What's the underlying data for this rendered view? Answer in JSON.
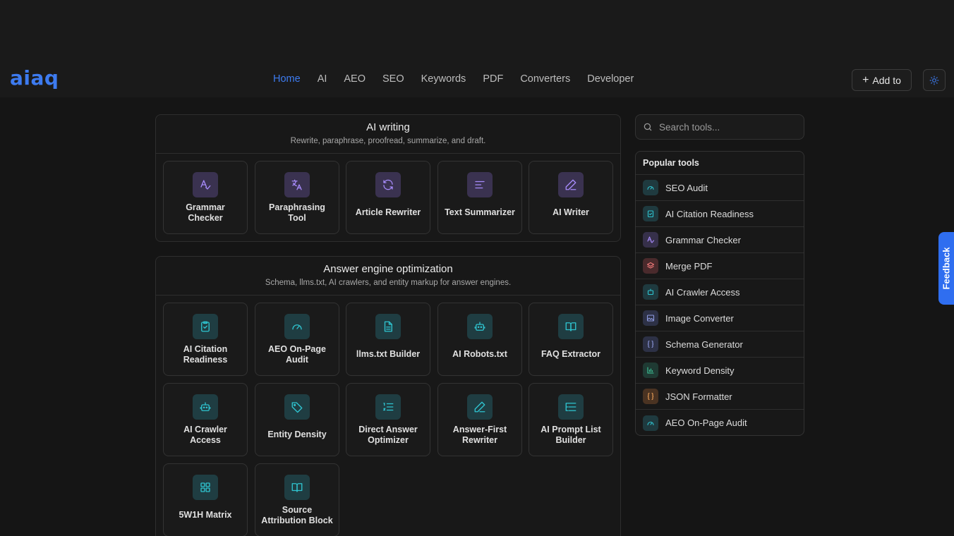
{
  "brand": {
    "logo": "aiaq"
  },
  "nav": {
    "items": [
      "Home",
      "AI",
      "AEO",
      "SEO",
      "Keywords",
      "PDF",
      "Converters",
      "Developer"
    ],
    "active": "Home"
  },
  "header": {
    "add_label": "Add to"
  },
  "sections": [
    {
      "title": "AI writing",
      "subtitle": "Rewrite, paraphrase, proofread, summarize, and draft.",
      "tools": [
        {
          "label": "Grammar Checker",
          "icon": "grammar-icon"
        },
        {
          "label": "Paraphrasing Tool",
          "icon": "translate-icon"
        },
        {
          "label": "Article Rewriter",
          "icon": "refresh-icon"
        },
        {
          "label": "Text Summarizer",
          "icon": "text-lines-icon"
        },
        {
          "label": "AI Writer",
          "icon": "pencil-icon"
        }
      ]
    },
    {
      "title": "Answer engine optimization",
      "subtitle": "Schema, llms.txt, AI crawlers, and entity markup for answer engines.",
      "tools": [
        {
          "label": "AI Citation Readiness",
          "icon": "clipboard-check-icon"
        },
        {
          "label": "AEO On-Page Audit",
          "icon": "gauge-icon"
        },
        {
          "label": "llms.txt Builder",
          "icon": "document-icon"
        },
        {
          "label": "AI Robots.txt",
          "icon": "robot-icon"
        },
        {
          "label": "FAQ Extractor",
          "icon": "book-icon"
        },
        {
          "label": "AI Crawler Access",
          "icon": "robot-icon"
        },
        {
          "label": "Entity Density",
          "icon": "tag-icon"
        },
        {
          "label": "Direct Answer Optimizer",
          "icon": "list-numbered-icon"
        },
        {
          "label": "Answer-First Rewriter",
          "icon": "pencil-icon"
        },
        {
          "label": "AI Prompt List Builder",
          "icon": "list-tree-icon"
        },
        {
          "label": "5W1H Matrix",
          "icon": "grid-icon"
        },
        {
          "label": "Source Attribution Block",
          "icon": "book-icon"
        }
      ]
    }
  ],
  "search": {
    "placeholder": "Search tools..."
  },
  "popular": {
    "title": "Popular tools",
    "items": [
      {
        "label": "SEO Audit",
        "icon": "gauge-icon",
        "tone": "teal"
      },
      {
        "label": "AI Citation Readiness",
        "icon": "clipboard-check-icon",
        "tone": "teal"
      },
      {
        "label": "Grammar Checker",
        "icon": "grammar-icon",
        "tone": "purple"
      },
      {
        "label": "Merge PDF",
        "icon": "layers-icon",
        "tone": "red"
      },
      {
        "label": "AI Crawler Access",
        "icon": "robot-icon",
        "tone": "teal"
      },
      {
        "label": "Image Converter",
        "icon": "image-icon",
        "tone": "slate"
      },
      {
        "label": "Schema Generator",
        "icon": "braces-icon",
        "tone": "slate"
      },
      {
        "label": "Keyword Density",
        "icon": "bar-chart-icon",
        "tone": "green"
      },
      {
        "label": "JSON Formatter",
        "icon": "braces-icon",
        "tone": "orange"
      },
      {
        "label": "AEO On-Page Audit",
        "icon": "gauge-icon",
        "tone": "teal"
      }
    ]
  },
  "feedback": {
    "label": "Feedback"
  },
  "colors": {
    "accent": "#3d7bf0",
    "purple_icon": "#a78bfa",
    "teal_icon": "#2fc4d0"
  }
}
